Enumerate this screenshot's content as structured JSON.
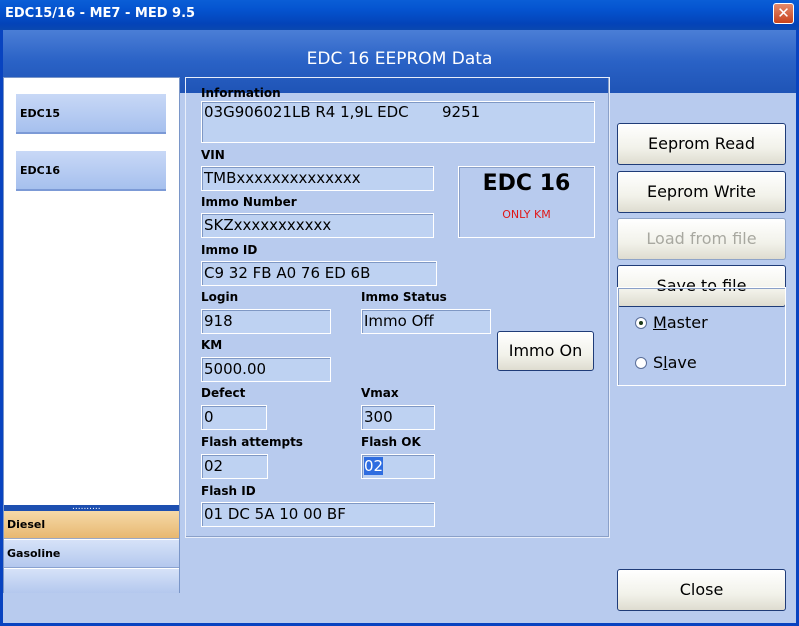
{
  "window": {
    "title": "EDC15/16 - ME7 - MED 9.5",
    "close_glyph": "✕",
    "header": "EDC 16 EEPROM Data"
  },
  "sidebar": {
    "ecus": [
      "EDC15",
      "EDC16"
    ],
    "grip": "..........",
    "fuel": [
      "Diesel",
      "Gasoline"
    ]
  },
  "fields": {
    "information_label": "Information",
    "information_value": "03G906021LB R4 1,9L EDC       9251",
    "vin_label": "VIN",
    "vin_value": "TMBxxxxxxxxxxxxxx",
    "immo_number_label": "Immo Number",
    "immo_number_value": "SKZxxxxxxxxxxx",
    "immo_id_label": "Immo ID",
    "immo_id_value": "C9 32 FB A0 76 ED 6B",
    "login_label": "Login",
    "login_value": "918",
    "immo_status_label": "Immo Status",
    "immo_status_value": "Immo Off",
    "km_label": "KM",
    "km_value": "5000.00",
    "defect_label": "Defect",
    "defect_value": "0",
    "vmax_label": "Vmax",
    "vmax_value": "300",
    "flash_attempts_label": "Flash attempts",
    "flash_attempts_value": "02",
    "flash_ok_label": "Flash OK",
    "flash_ok_value": "02",
    "flash_id_label": "Flash ID",
    "flash_id_value": "01 DC 5A 10 00 BF"
  },
  "ecu_box": {
    "title": "EDC 16",
    "subtitle": "ONLY KM"
  },
  "buttons": {
    "immo_on": "Immo On",
    "eeprom_read": "Eeprom Read",
    "eeprom_write": "Eeprom Write",
    "load_from_file": "Load from file",
    "save_to_file": "Save to file",
    "close": "Close"
  },
  "mode": {
    "master_underlined": "M",
    "master_rest": "aster",
    "slave_first": "S",
    "slave_underlined": "l",
    "slave_rest": "ave",
    "selected": "Master"
  }
}
